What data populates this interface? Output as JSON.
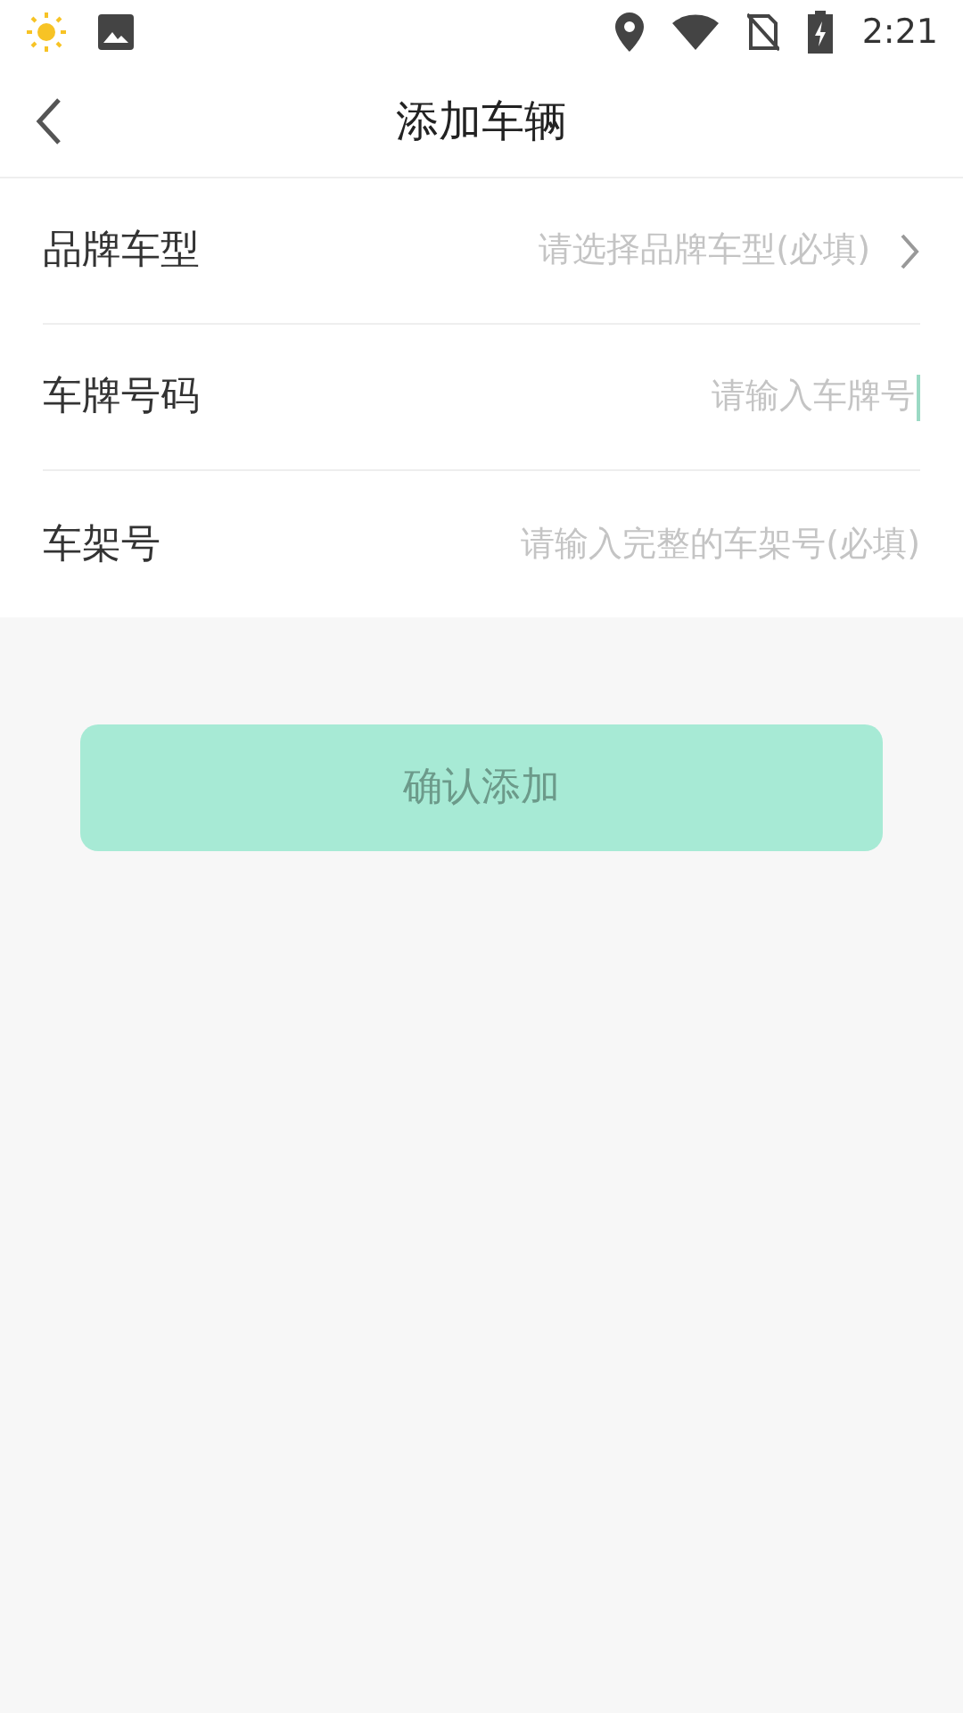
{
  "status_bar": {
    "time": "2:21"
  },
  "header": {
    "title": "添加车辆"
  },
  "form": [
    {
      "kind": "select",
      "label": "品牌车型",
      "placeholder": "请选择品牌车型(必填)",
      "focused": false
    },
    {
      "kind": "input",
      "label": "车牌号码",
      "placeholder": "请输入车牌号",
      "focused": true
    },
    {
      "kind": "input",
      "label": "车架号",
      "placeholder": "请输入完整的车架号(必填)",
      "focused": false
    }
  ],
  "submit": {
    "label": "确认添加",
    "disabled": true
  }
}
